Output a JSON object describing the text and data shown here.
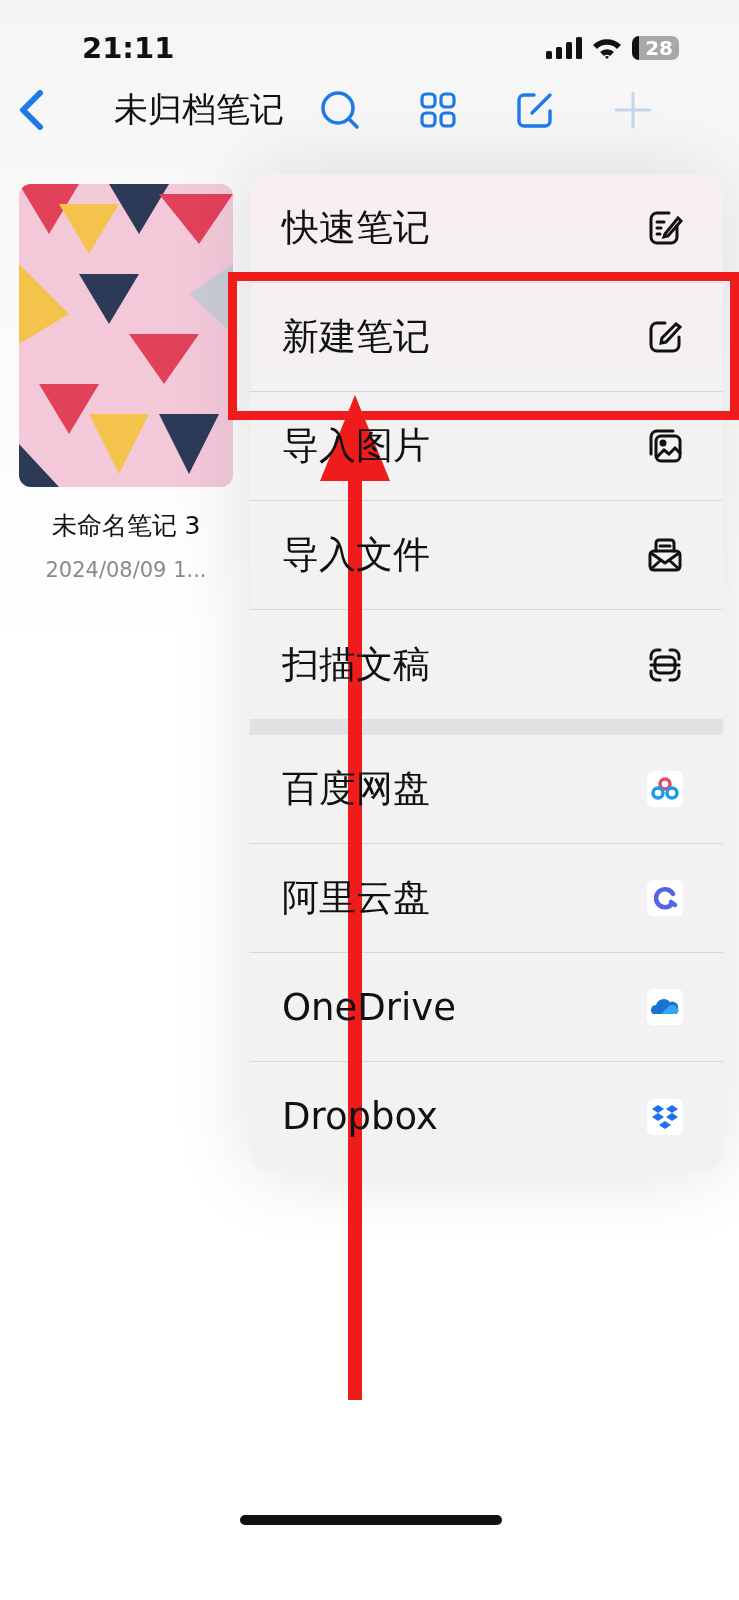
{
  "status_bar": {
    "time": "21:11",
    "battery": "28"
  },
  "nav": {
    "title": "未归档笔记"
  },
  "notes": [
    {
      "kind": "picture",
      "title": "未命名笔记 3",
      "date": "2024/08/09 1..."
    }
  ],
  "menu": {
    "groups": [
      [
        {
          "label": "快速笔记"
        },
        {
          "label": "新建笔记"
        },
        {
          "label": "导入图片"
        },
        {
          "label": "导入文件"
        },
        {
          "label": "扫描文稿"
        }
      ],
      [
        {
          "label": "百度网盘"
        },
        {
          "label": "阿里云盘"
        },
        {
          "label": "OneDrive"
        },
        {
          "label": "Dropbox"
        }
      ]
    ]
  }
}
